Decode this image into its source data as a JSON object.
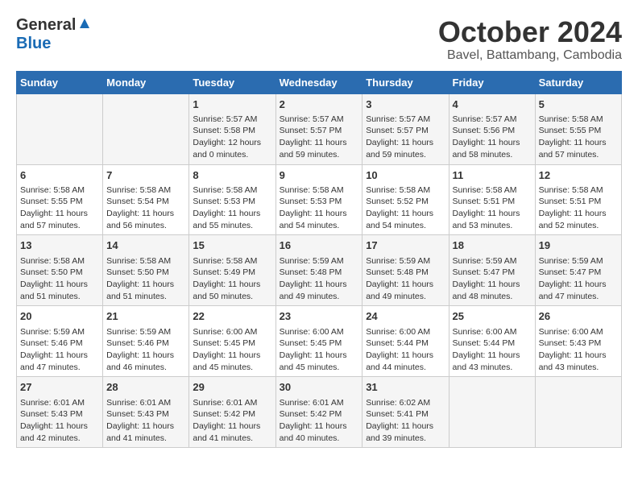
{
  "header": {
    "logo_general": "General",
    "logo_blue": "Blue",
    "month": "October 2024",
    "location": "Bavel, Battambang, Cambodia"
  },
  "calendar": {
    "days_of_week": [
      "Sunday",
      "Monday",
      "Tuesday",
      "Wednesday",
      "Thursday",
      "Friday",
      "Saturday"
    ],
    "weeks": [
      [
        {
          "day": "",
          "info": ""
        },
        {
          "day": "",
          "info": ""
        },
        {
          "day": "1",
          "info": "Sunrise: 5:57 AM\nSunset: 5:58 PM\nDaylight: 12 hours and 0 minutes."
        },
        {
          "day": "2",
          "info": "Sunrise: 5:57 AM\nSunset: 5:57 PM\nDaylight: 11 hours and 59 minutes."
        },
        {
          "day": "3",
          "info": "Sunrise: 5:57 AM\nSunset: 5:57 PM\nDaylight: 11 hours and 59 minutes."
        },
        {
          "day": "4",
          "info": "Sunrise: 5:57 AM\nSunset: 5:56 PM\nDaylight: 11 hours and 58 minutes."
        },
        {
          "day": "5",
          "info": "Sunrise: 5:58 AM\nSunset: 5:55 PM\nDaylight: 11 hours and 57 minutes."
        }
      ],
      [
        {
          "day": "6",
          "info": "Sunrise: 5:58 AM\nSunset: 5:55 PM\nDaylight: 11 hours and 57 minutes."
        },
        {
          "day": "7",
          "info": "Sunrise: 5:58 AM\nSunset: 5:54 PM\nDaylight: 11 hours and 56 minutes."
        },
        {
          "day": "8",
          "info": "Sunrise: 5:58 AM\nSunset: 5:53 PM\nDaylight: 11 hours and 55 minutes."
        },
        {
          "day": "9",
          "info": "Sunrise: 5:58 AM\nSunset: 5:53 PM\nDaylight: 11 hours and 54 minutes."
        },
        {
          "day": "10",
          "info": "Sunrise: 5:58 AM\nSunset: 5:52 PM\nDaylight: 11 hours and 54 minutes."
        },
        {
          "day": "11",
          "info": "Sunrise: 5:58 AM\nSunset: 5:51 PM\nDaylight: 11 hours and 53 minutes."
        },
        {
          "day": "12",
          "info": "Sunrise: 5:58 AM\nSunset: 5:51 PM\nDaylight: 11 hours and 52 minutes."
        }
      ],
      [
        {
          "day": "13",
          "info": "Sunrise: 5:58 AM\nSunset: 5:50 PM\nDaylight: 11 hours and 51 minutes."
        },
        {
          "day": "14",
          "info": "Sunrise: 5:58 AM\nSunset: 5:50 PM\nDaylight: 11 hours and 51 minutes."
        },
        {
          "day": "15",
          "info": "Sunrise: 5:58 AM\nSunset: 5:49 PM\nDaylight: 11 hours and 50 minutes."
        },
        {
          "day": "16",
          "info": "Sunrise: 5:59 AM\nSunset: 5:48 PM\nDaylight: 11 hours and 49 minutes."
        },
        {
          "day": "17",
          "info": "Sunrise: 5:59 AM\nSunset: 5:48 PM\nDaylight: 11 hours and 49 minutes."
        },
        {
          "day": "18",
          "info": "Sunrise: 5:59 AM\nSunset: 5:47 PM\nDaylight: 11 hours and 48 minutes."
        },
        {
          "day": "19",
          "info": "Sunrise: 5:59 AM\nSunset: 5:47 PM\nDaylight: 11 hours and 47 minutes."
        }
      ],
      [
        {
          "day": "20",
          "info": "Sunrise: 5:59 AM\nSunset: 5:46 PM\nDaylight: 11 hours and 47 minutes."
        },
        {
          "day": "21",
          "info": "Sunrise: 5:59 AM\nSunset: 5:46 PM\nDaylight: 11 hours and 46 minutes."
        },
        {
          "day": "22",
          "info": "Sunrise: 6:00 AM\nSunset: 5:45 PM\nDaylight: 11 hours and 45 minutes."
        },
        {
          "day": "23",
          "info": "Sunrise: 6:00 AM\nSunset: 5:45 PM\nDaylight: 11 hours and 45 minutes."
        },
        {
          "day": "24",
          "info": "Sunrise: 6:00 AM\nSunset: 5:44 PM\nDaylight: 11 hours and 44 minutes."
        },
        {
          "day": "25",
          "info": "Sunrise: 6:00 AM\nSunset: 5:44 PM\nDaylight: 11 hours and 43 minutes."
        },
        {
          "day": "26",
          "info": "Sunrise: 6:00 AM\nSunset: 5:43 PM\nDaylight: 11 hours and 43 minutes."
        }
      ],
      [
        {
          "day": "27",
          "info": "Sunrise: 6:01 AM\nSunset: 5:43 PM\nDaylight: 11 hours and 42 minutes."
        },
        {
          "day": "28",
          "info": "Sunrise: 6:01 AM\nSunset: 5:43 PM\nDaylight: 11 hours and 41 minutes."
        },
        {
          "day": "29",
          "info": "Sunrise: 6:01 AM\nSunset: 5:42 PM\nDaylight: 11 hours and 41 minutes."
        },
        {
          "day": "30",
          "info": "Sunrise: 6:01 AM\nSunset: 5:42 PM\nDaylight: 11 hours and 40 minutes."
        },
        {
          "day": "31",
          "info": "Sunrise: 6:02 AM\nSunset: 5:41 PM\nDaylight: 11 hours and 39 minutes."
        },
        {
          "day": "",
          "info": ""
        },
        {
          "day": "",
          "info": ""
        }
      ]
    ]
  }
}
